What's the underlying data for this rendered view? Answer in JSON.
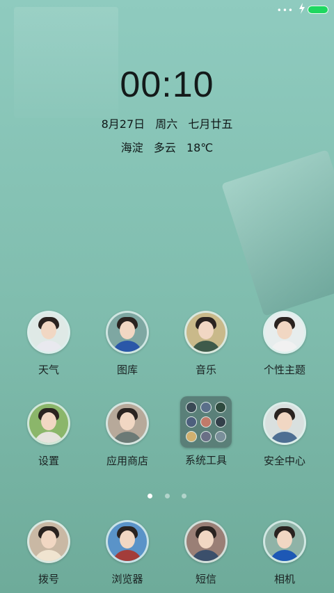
{
  "status_bar": {
    "dots": "•••",
    "charging_icon": "bolt-icon",
    "battery_color": "#1ed760"
  },
  "lockscreen": {
    "time": "00:10",
    "date": "8月27日",
    "weekday": "周六",
    "lunar_date": "七月廿五",
    "location": "海淀",
    "weather": "多云",
    "temperature": "18℃"
  },
  "apps_row1": [
    {
      "label": "天气",
      "body_color": "#e9e9ef"
    },
    {
      "label": "图库",
      "body_color": "#2a57a8"
    },
    {
      "label": "音乐",
      "body_color": "#3f5a4a"
    },
    {
      "label": "个性主题",
      "body_color": "#f1f1f1"
    }
  ],
  "apps_row2": [
    {
      "label": "设置",
      "body_color": "#e6e3dd"
    },
    {
      "label": "应用商店",
      "body_color": "#6b7a76"
    },
    {
      "label": "系统工具",
      "folder": true
    },
    {
      "label": "安全中心",
      "body_color": "#4e6f93"
    }
  ],
  "dock": [
    {
      "label": "拨号",
      "body_color": "#f0e4d0"
    },
    {
      "label": "浏览器",
      "body_color": "#a33d3a"
    },
    {
      "label": "短信",
      "body_color": "#3b4f6b"
    },
    {
      "label": "相机",
      "body_color": "#1d58b5"
    }
  ],
  "page_indicator": {
    "count": 3,
    "active": 0
  }
}
